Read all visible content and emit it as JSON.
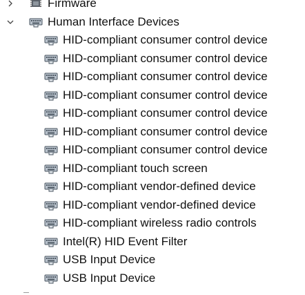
{
  "tree": {
    "firmware": {
      "label": "Firmware",
      "expanded": false,
      "icon": "firmware-chip-icon"
    },
    "hid": {
      "label": "Human Interface Devices",
      "expanded": true,
      "icon": "hid-device-icon",
      "children": [
        {
          "label": "HID-compliant consumer control device",
          "icon": "hid-device-icon"
        },
        {
          "label": "HID-compliant consumer control device",
          "icon": "hid-device-icon"
        },
        {
          "label": "HID-compliant consumer control device",
          "icon": "hid-device-icon"
        },
        {
          "label": "HID-compliant consumer control device",
          "icon": "hid-device-icon"
        },
        {
          "label": "HID-compliant consumer control device",
          "icon": "hid-device-icon"
        },
        {
          "label": "HID-compliant consumer control device",
          "icon": "hid-device-icon"
        },
        {
          "label": "HID-compliant consumer control device",
          "icon": "hid-device-icon"
        },
        {
          "label": "HID-compliant touch screen",
          "icon": "hid-device-icon"
        },
        {
          "label": "HID-compliant vendor-defined device",
          "icon": "hid-device-icon"
        },
        {
          "label": "HID-compliant vendor-defined device",
          "icon": "hid-device-icon"
        },
        {
          "label": "HID-compliant wireless radio controls",
          "icon": "hid-device-icon"
        },
        {
          "label": "Intel(R) HID Event Filter",
          "icon": "hid-device-icon"
        },
        {
          "label": "USB Input Device",
          "icon": "hid-device-icon"
        },
        {
          "label": "USB Input Device",
          "icon": "hid-device-icon"
        }
      ]
    }
  },
  "colors": {
    "text": "#111111",
    "icon_body": "#b9c2cc",
    "icon_dark": "#4a5560",
    "chip": "#5a6068"
  }
}
